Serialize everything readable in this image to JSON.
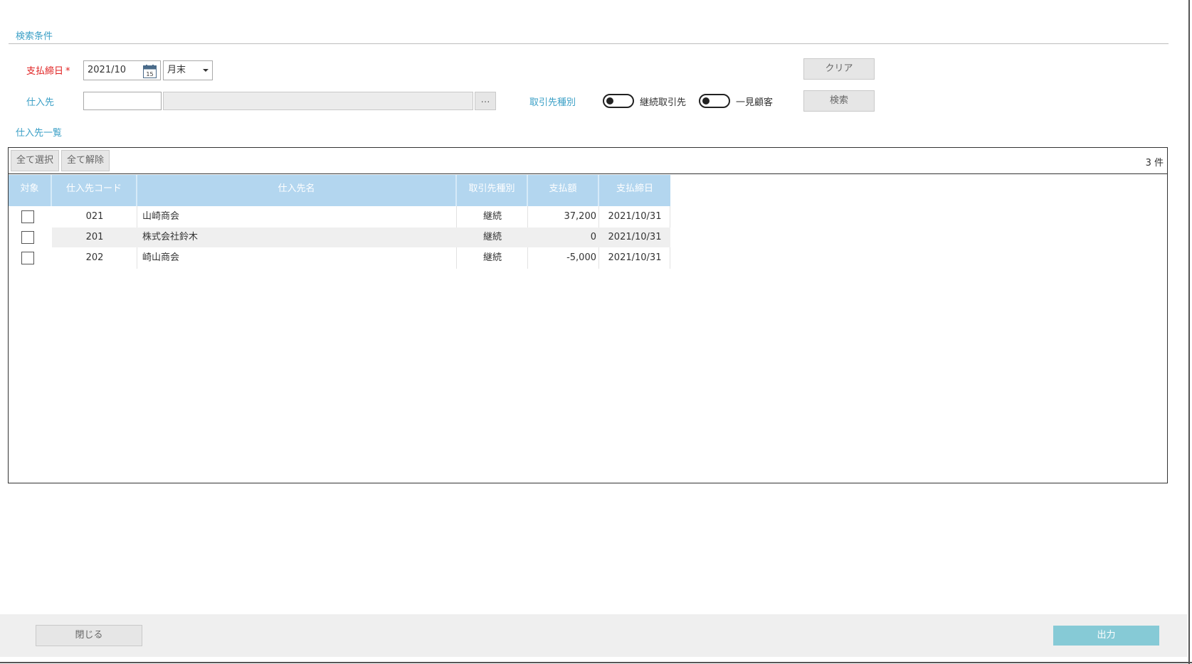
{
  "search": {
    "section_title": "検索条件",
    "pay_close_label": "支払締日",
    "required_mark": "*",
    "pay_close_value": "2021/10",
    "calendar_day": "15",
    "period_select": "月末",
    "supplier_label": "仕入先",
    "supplier_code": "",
    "supplier_name": "",
    "lookup_label": "…",
    "partner_type_label": "取引先種別",
    "toggle_continuous_label": "継続取引先",
    "toggle_oneoff_label": "一見顧客",
    "clear_button": "クリア",
    "search_button": "検索"
  },
  "list": {
    "section_title": "仕入先一覧",
    "select_all": "全て選択",
    "deselect_all": "全て解除",
    "count": "3",
    "count_unit": "件",
    "columns": [
      "対象",
      "仕入先コード",
      "仕入先名",
      "取引先種別",
      "支払額",
      "支払締日"
    ],
    "rows": [
      {
        "code": "021",
        "name": "山崎商会",
        "type": "継続",
        "amount": "37,200",
        "date": "2021/10/31"
      },
      {
        "code": "201",
        "name": "株式会社鈴木",
        "type": "継続",
        "amount": "0",
        "date": "2021/10/31"
      },
      {
        "code": "202",
        "name": "崎山商会",
        "type": "継続",
        "amount": "-5,000",
        "date": "2021/10/31"
      }
    ]
  },
  "footer": {
    "close_button": "閉じる",
    "output_button": "出力"
  },
  "colors": {
    "accent": "#3a9fc6",
    "required": "#e02020",
    "header_bg": "#b3d6ef",
    "output_button_bg": "#86cad6"
  }
}
